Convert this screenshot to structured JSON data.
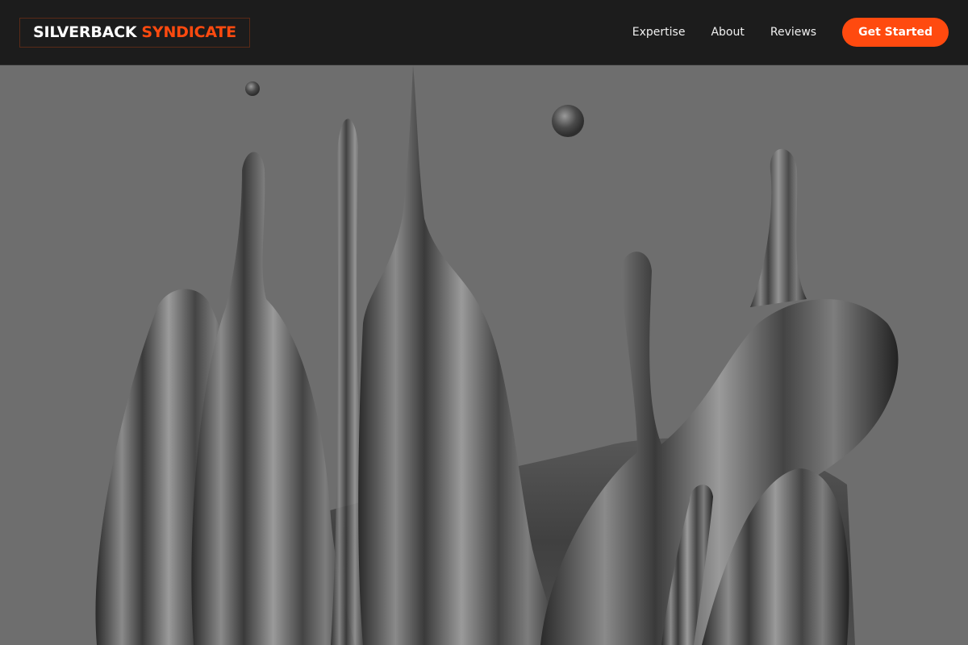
{
  "brand": {
    "name_part1": "SILVERBACK",
    "name_part2": "SYNDICATE",
    "accent_color": "#ff4a0f"
  },
  "nav": {
    "links": [
      {
        "label": "Expertise"
      },
      {
        "label": "About"
      },
      {
        "label": "Reviews"
      }
    ],
    "cta_label": "Get Started"
  },
  "hero": {
    "image": "liquid-splash-image",
    "tone": "grayscale"
  },
  "colors": {
    "navbar_bg": "#1c1c1c",
    "hero_bg": "#6d6d6d",
    "cta_bg": "#ff4a0f",
    "text_light": "#f0f0f0"
  }
}
